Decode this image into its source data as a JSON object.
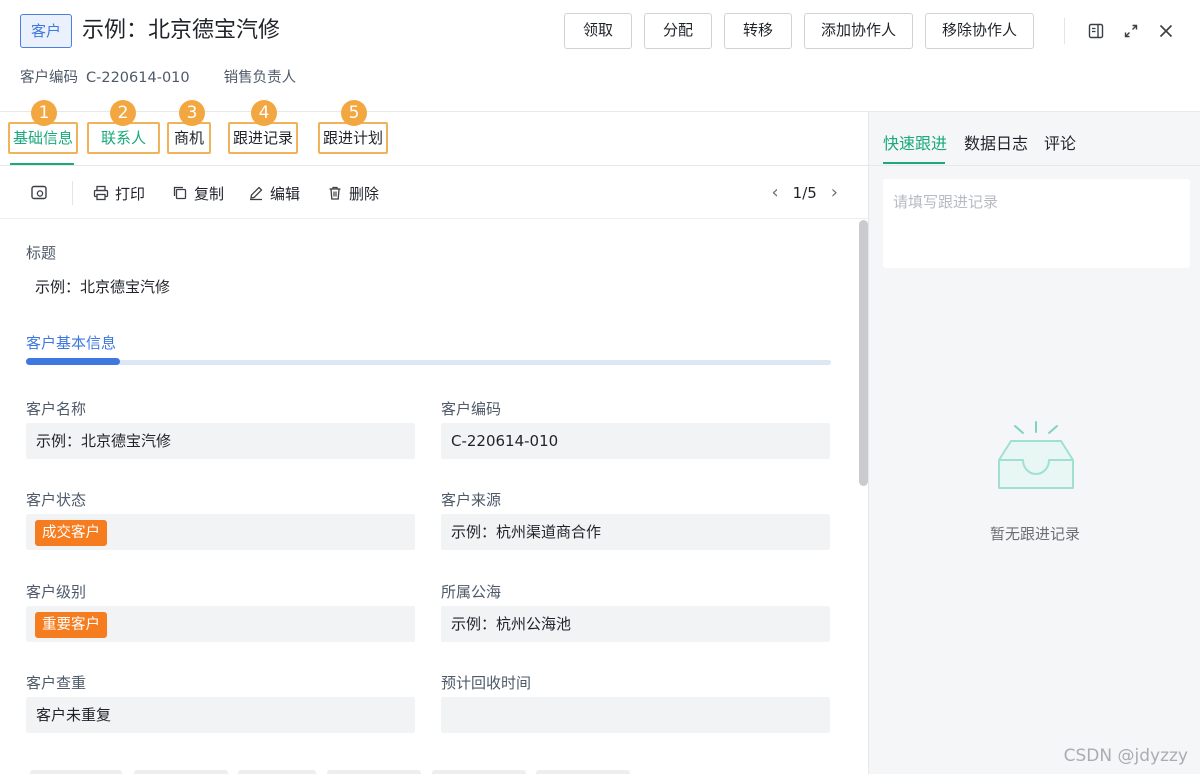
{
  "header": {
    "type_tag": "客户",
    "title": "示例：北京德宝汽修",
    "actions": [
      "领取",
      "分配",
      "转移",
      "添加协作人",
      "移除协作人"
    ],
    "meta": {
      "code_label": "客户编码",
      "code_value": "C-220614-010",
      "owner_label": "销售负责人"
    },
    "window_icons": [
      "sidebar-toggle-icon",
      "expand-icon",
      "close-icon"
    ]
  },
  "tabs": [
    {
      "num": "1",
      "label": "基础信息",
      "active": true
    },
    {
      "num": "2",
      "label": "联系人",
      "active": false
    },
    {
      "num": "3",
      "label": "商机",
      "active": false
    },
    {
      "num": "4",
      "label": "跟进记录",
      "active": false
    },
    {
      "num": "5",
      "label": "跟进计划",
      "active": false
    }
  ],
  "toolbar": {
    "print": "打印",
    "copy": "复制",
    "edit": "编辑",
    "delete": "删除",
    "page": "1/5"
  },
  "detail": {
    "title_label": "标题",
    "title_value": "示例：北京德宝汽修",
    "section_title": "客户基本信息",
    "fields": {
      "name_label": "客户名称",
      "name_value": "示例：北京德宝汽修",
      "code_label": "客户编码",
      "code_value": "C-220614-010",
      "status_label": "客户状态",
      "status_value": "成交客户",
      "source_label": "客户来源",
      "source_value": "示例：杭州渠道商合作",
      "level_label": "客户级别",
      "level_value": "重要客户",
      "pool_label": "所属公海",
      "pool_value": "示例：杭州公海池",
      "dup_label": "客户查重",
      "dup_value": "客户未重复",
      "recover_label": "预计回收时间",
      "recover_value": ""
    }
  },
  "right_panel": {
    "tabs": [
      "快速跟进",
      "数据日志",
      "评论"
    ],
    "placeholder": "请填写跟进记录",
    "empty_text": "暂无跟进记录"
  },
  "watermark": "CSDN @jdyzzy",
  "colors": {
    "accent_green": "#19a97b",
    "accent_blue": "#3d78de",
    "badge_orange": "#f57c1f",
    "annotation_orange": "#f3a740"
  }
}
